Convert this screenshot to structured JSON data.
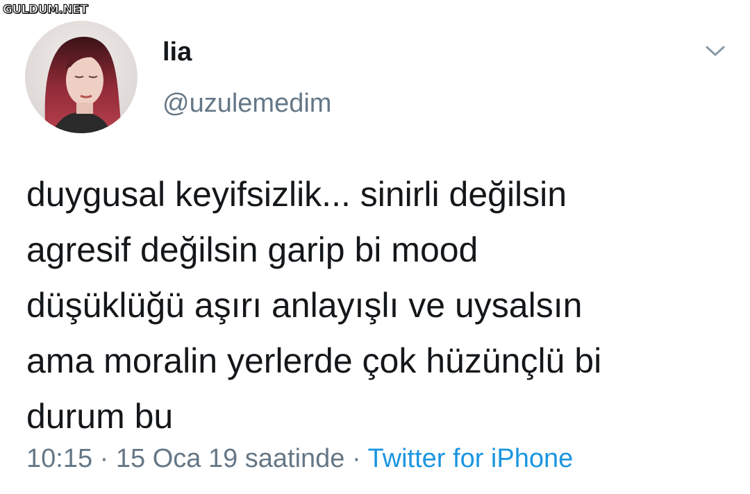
{
  "watermark": "GULDUM.NET",
  "tweet": {
    "display_name": "lia",
    "handle": "@uzulemedim",
    "text": "duygusal keyifsizlik... sinirli değilsin\nagresif değilsin garip bi mood\ndüşüklüğü aşırı anlayışlı ve uysalsın\nama moralin yerlerde çok hüzünçlü bi\ndurum bu",
    "time": "10:15",
    "date": "15 Oca 19 saatinde",
    "separator": "·",
    "source": "Twitter for iPhone"
  },
  "icons": {
    "more": "chevron-down-icon",
    "avatar": "profile-photo"
  },
  "colors": {
    "text": "#14171a",
    "secondary": "#657786",
    "link": "#1b95e0",
    "background": "#ffffff"
  }
}
